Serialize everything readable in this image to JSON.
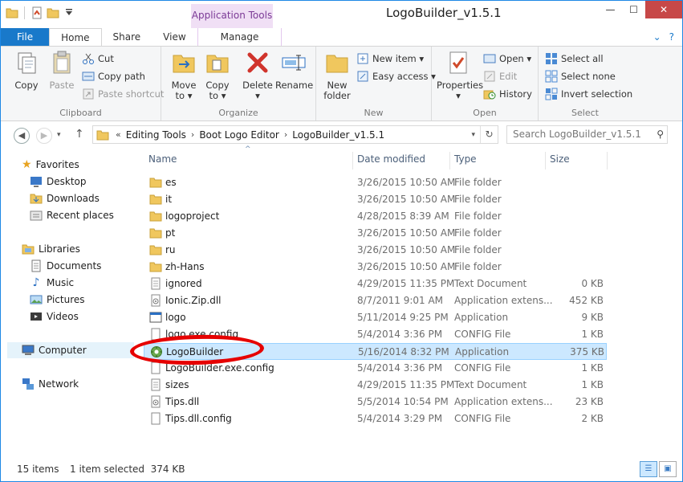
{
  "window": {
    "title": "LogoBuilder_v1.5.1",
    "context_tab_group": "Application Tools"
  },
  "titlebar": {
    "min": "—",
    "max": "☐",
    "close": "✕"
  },
  "tabs": [
    {
      "label": "File"
    },
    {
      "label": "Home"
    },
    {
      "label": "Share"
    },
    {
      "label": "View"
    },
    {
      "label": "Manage"
    }
  ],
  "ribbon": {
    "clipboard": {
      "label": "Clipboard",
      "copy": "Copy",
      "paste": "Paste",
      "cut": "Cut",
      "copy_path": "Copy path",
      "paste_shortcut": "Paste shortcut"
    },
    "organize": {
      "label": "Organize",
      "move_to": "Move",
      "move_to2": "to ▾",
      "copy_to": "Copy",
      "copy_to2": "to ▾",
      "delete": "Delete",
      "delete2": "▾",
      "rename": "Rename"
    },
    "new": {
      "label": "New",
      "new_folder": "New",
      "new_folder2": "folder",
      "new_item": "New item ▾",
      "easy_access": "Easy access ▾"
    },
    "open": {
      "label": "Open",
      "properties": "Properties",
      "properties2": "▾",
      "open": "Open ▾",
      "edit": "Edit",
      "history": "History"
    },
    "select": {
      "label": "Select",
      "select_all": "Select all",
      "select_none": "Select none",
      "invert_selection": "Invert selection"
    }
  },
  "address": {
    "overflow": "«",
    "crumbs": [
      "Editing Tools",
      "Boot Logo Editor",
      "LogoBuilder_v1.5.1"
    ],
    "search_placeholder": "Search LogoBuilder_v1.5.1"
  },
  "nav": {
    "favorites": "Favorites",
    "desktop": "Desktop",
    "downloads": "Downloads",
    "recent_places": "Recent places",
    "libraries": "Libraries",
    "documents": "Documents",
    "music": "Music",
    "pictures": "Pictures",
    "videos": "Videos",
    "computer": "Computer",
    "network": "Network"
  },
  "columns": {
    "name": "Name",
    "date": "Date modified",
    "type": "Type",
    "size": "Size"
  },
  "files": [
    {
      "name": "es",
      "date": "3/26/2015 10:50 AM",
      "type": "File folder",
      "size": "",
      "icon": "folder-icon"
    },
    {
      "name": "it",
      "date": "3/26/2015 10:50 AM",
      "type": "File folder",
      "size": "",
      "icon": "folder-icon"
    },
    {
      "name": "logoproject",
      "date": "4/28/2015 8:39 AM",
      "type": "File folder",
      "size": "",
      "icon": "folder-icon"
    },
    {
      "name": "pt",
      "date": "3/26/2015 10:50 AM",
      "type": "File folder",
      "size": "",
      "icon": "folder-icon"
    },
    {
      "name": "ru",
      "date": "3/26/2015 10:50 AM",
      "type": "File folder",
      "size": "",
      "icon": "folder-icon"
    },
    {
      "name": "zh-Hans",
      "date": "3/26/2015 10:50 AM",
      "type": "File folder",
      "size": "",
      "icon": "folder-icon"
    },
    {
      "name": "ignored",
      "date": "4/29/2015 11:35 PM",
      "type": "Text Document",
      "size": "0 KB",
      "icon": "text-file-icon"
    },
    {
      "name": "Ionic.Zip.dll",
      "date": "8/7/2011 9:01 AM",
      "type": "Application extens...",
      "size": "452 KB",
      "icon": "dll-icon"
    },
    {
      "name": "logo",
      "date": "5/11/2014 9:25 PM",
      "type": "Application",
      "size": "9 KB",
      "icon": "app-icon"
    },
    {
      "name": "logo.exe.config",
      "date": "5/4/2014 3:36 PM",
      "type": "CONFIG File",
      "size": "1 KB",
      "icon": "config-file-icon"
    },
    {
      "name": "LogoBuilder",
      "date": "5/16/2014 8:32 PM",
      "type": "Application",
      "size": "375 KB",
      "icon": "logobuilder-app-icon"
    },
    {
      "name": "LogoBuilder.exe.config",
      "date": "5/4/2014 3:36 PM",
      "type": "CONFIG File",
      "size": "1 KB",
      "icon": "config-file-icon"
    },
    {
      "name": "sizes",
      "date": "4/29/2015 11:35 PM",
      "type": "Text Document",
      "size": "1 KB",
      "icon": "text-file-icon"
    },
    {
      "name": "Tips.dll",
      "date": "5/5/2014 10:54 PM",
      "type": "Application extens...",
      "size": "23 KB",
      "icon": "dll-icon"
    },
    {
      "name": "Tips.dll.config",
      "date": "5/4/2014 3:29 PM",
      "type": "CONFIG File",
      "size": "2 KB",
      "icon": "config-file-icon"
    }
  ],
  "selected_index": 10,
  "status": {
    "items": "15 items",
    "selection": "1 item selected  374 KB"
  },
  "colors": {
    "accent": "#1979ca",
    "selection": "#cce8ff",
    "highlight_circle": "#e60000",
    "context_tab": "#f0dff5"
  }
}
